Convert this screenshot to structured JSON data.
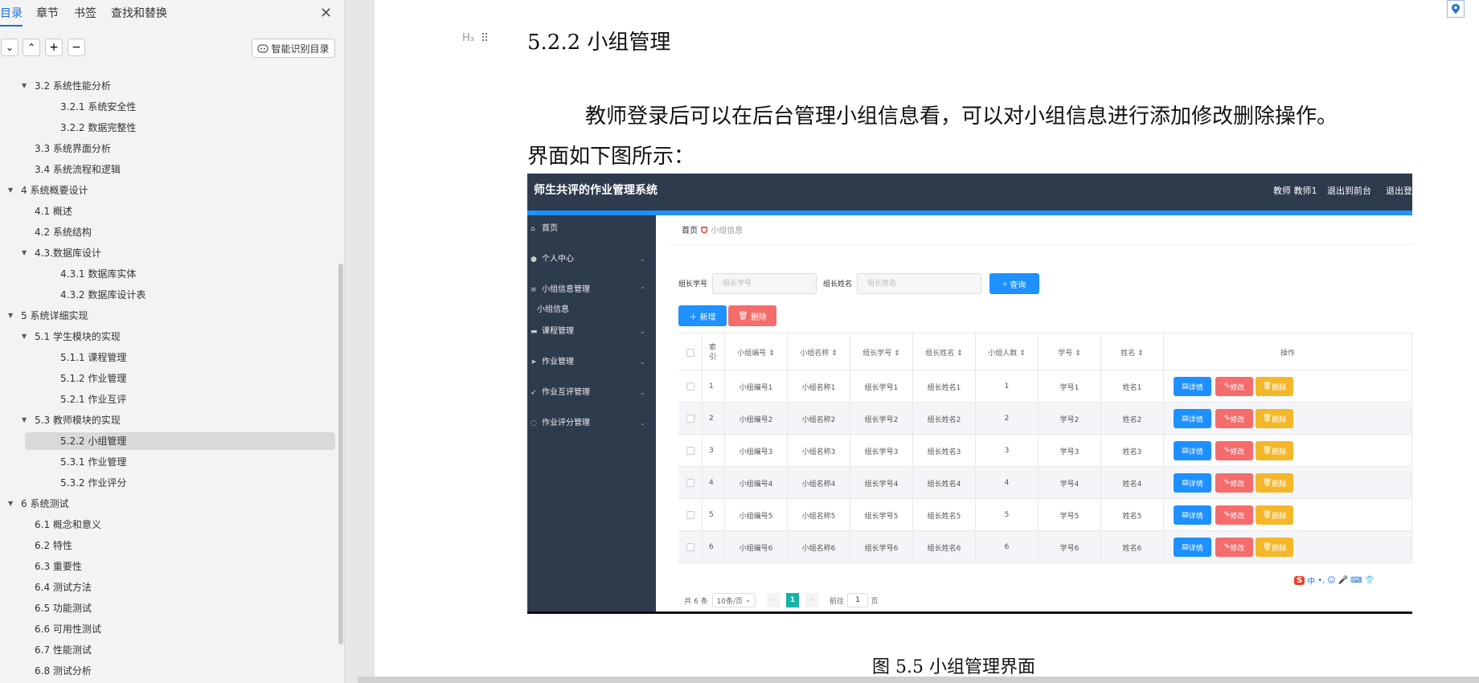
{
  "nav": {
    "tabs": [
      "目录",
      "章节",
      "书签",
      "查找和替换"
    ],
    "close": "✕",
    "tools": [
      "⌄",
      "⌃",
      "+",
      "−"
    ],
    "smart_button": "智能识别目录",
    "toc": [
      {
        "label": "3.2 系统性能分析",
        "level": 2,
        "expanded": true
      },
      {
        "label": "3.2.1  系统安全性",
        "level": 3
      },
      {
        "label": "3.2.2  数据完整性",
        "level": 3
      },
      {
        "label": "3.3 系统界面分析",
        "level": 2
      },
      {
        "label": "3.4 系统流程和逻辑",
        "level": 2
      },
      {
        "label": "4 系统概要设计",
        "level": 1,
        "expanded": true
      },
      {
        "label": "4.1 概述",
        "level": 2
      },
      {
        "label": "4.2 系统结构",
        "level": 2
      },
      {
        "label": "4.3.数据库设计",
        "level": 2,
        "expanded": true
      },
      {
        "label": "4.3.1 数据库实体",
        "level": 3
      },
      {
        "label": "4.3.2 数据库设计表",
        "level": 3
      },
      {
        "label": "5 系统详细实现",
        "level": 1,
        "expanded": true
      },
      {
        "label": "5.1  学生模块的实现",
        "level": 2,
        "expanded": true
      },
      {
        "label": "5.1.1  课程管理",
        "level": 3
      },
      {
        "label": "5.1.2  作业管理",
        "level": 3
      },
      {
        "label": "5.2.1  作业互评",
        "level": 3
      },
      {
        "label": "5.3  教师模块的实现",
        "level": 2,
        "expanded": true
      },
      {
        "label": "5.2.2  小组管理",
        "level": 3,
        "selected": true
      },
      {
        "label": "5.3.1  作业管理",
        "level": 3
      },
      {
        "label": "5.3.2  作业评分",
        "level": 3
      },
      {
        "label": "6 系统测试",
        "level": 1,
        "expanded": true
      },
      {
        "label": "6.1 概念和意义",
        "level": 2
      },
      {
        "label": "6.2 特性",
        "level": 2
      },
      {
        "label": "6.3 重要性",
        "level": 2
      },
      {
        "label": "6.4 测试方法",
        "level": 2
      },
      {
        "label": "6.5  功能测试",
        "level": 2
      },
      {
        "label": "6.6 可用性测试",
        "level": 2
      },
      {
        "label": "6.7 性能测试",
        "level": 2
      },
      {
        "label": "6.8 测试分析",
        "level": 2
      }
    ]
  },
  "document": {
    "heading_marker": "H₃",
    "heading": "5.2.2  小组管理",
    "para_line1": "教师登录后可以在后台管理小组信息看，可以对小组信息进行添加修改删除操作。",
    "para_line2": "界面如下图所示：",
    "caption": "图 5.5  小组管理界面"
  },
  "app": {
    "title": "师生共评的作业管理系统",
    "top_links": [
      "教师 教师1",
      "退出到前台",
      "退出登"
    ],
    "sidebar": [
      {
        "icon": "⌂",
        "label": "首页",
        "chevron": false
      },
      {
        "icon": "●",
        "label": "个人中心",
        "chevron": true
      },
      {
        "icon": "≡",
        "label": "小组信息管理",
        "chevron": true,
        "open": true
      },
      {
        "icon": "▬",
        "label": "课程管理",
        "chevron": true
      },
      {
        "icon": "➤",
        "label": "作业管理",
        "chevron": true
      },
      {
        "icon": "➶",
        "label": "作业互评管理",
        "chevron": true
      },
      {
        "icon": "◌",
        "label": "作业评分管理",
        "chevron": true
      }
    ],
    "sidebar_sub": "小组信息",
    "breadcrumb": {
      "home": "首页",
      "current": "小组信息"
    },
    "search": {
      "label1": "组长学号",
      "placeholder1": "组长学号",
      "label2": "组长姓名",
      "placeholder2": "组长姓名",
      "query": "查询"
    },
    "add_button": "＋ 新增",
    "delete_button": "删除",
    "columns": [
      "索引",
      "小组编号 ⇕",
      "小组名称 ⇕",
      "组长学号 ⇕",
      "组长姓名 ⇕",
      "小组人数 ⇕",
      "学号 ⇕",
      "姓名 ⇕",
      "操作"
    ],
    "rows": [
      [
        "1",
        "小组编号1",
        "小组名称1",
        "组长学号1",
        "组长姓名1",
        "1",
        "学号1",
        "姓名1"
      ],
      [
        "2",
        "小组编号2",
        "小组名称2",
        "组长学号2",
        "组长姓名2",
        "2",
        "学号2",
        "姓名2"
      ],
      [
        "3",
        "小组编号3",
        "小组名称3",
        "组长学号3",
        "组长姓名3",
        "3",
        "学号3",
        "姓名3"
      ],
      [
        "4",
        "小组编号4",
        "小组名称4",
        "组长学号4",
        "组长姓名4",
        "4",
        "学号4",
        "姓名4"
      ],
      [
        "5",
        "小组编号5",
        "小组名称5",
        "组长学号5",
        "组长姓名5",
        "5",
        "学号5",
        "姓名5"
      ],
      [
        "6",
        "小组编号6",
        "小组名称6",
        "组长学号6",
        "组长姓名6",
        "6",
        "学号6",
        "姓名6"
      ]
    ],
    "ops": {
      "detail": "详情",
      "edit": "修改",
      "delete": "删除"
    },
    "pager": {
      "total": "共 6 条",
      "size": "10条/页",
      "page": "1",
      "goto": "前往",
      "goto_value": "1",
      "unit": "页"
    },
    "ime_icons": [
      "S",
      "中",
      "•,",
      "☺",
      "🎤",
      "⌨",
      "👕"
    ]
  },
  "colors": {
    "accent": "#1a6fd8",
    "app_dark": "#2d3b4d",
    "app_blue": "#1e90ff",
    "danger": "#f56c6c",
    "warning": "#f5b72a",
    "pager_active": "#13b5a6"
  }
}
